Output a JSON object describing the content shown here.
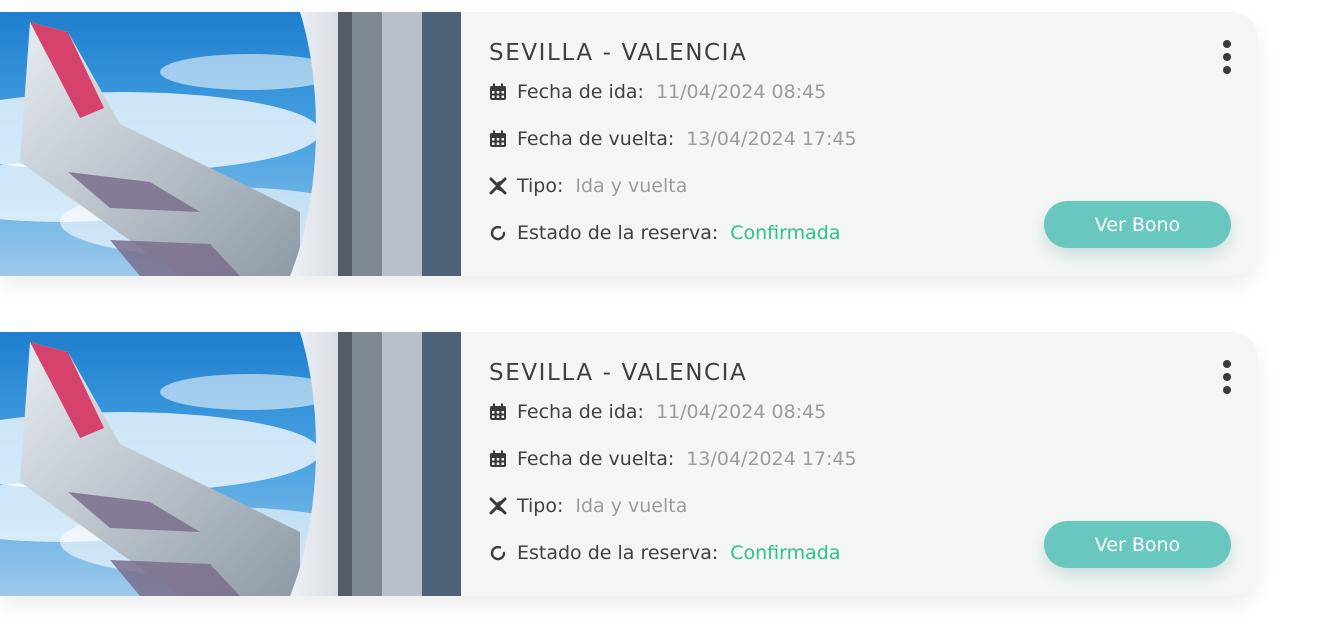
{
  "bookings": [
    {
      "route": "SEVILLA - VALENCIA",
      "departure_label": "Fecha de ida:",
      "departure_value": "11/04/2024 08:45",
      "return_label": "Fecha de vuelta:",
      "return_value": "13/04/2024 17:45",
      "type_label": "Tipo:",
      "type_value": "Ida y vuelta",
      "status_label": "Estado de la reserva:",
      "status_value": "Confirmada",
      "action_label": "Ver Bono"
    },
    {
      "route": "SEVILLA - VALENCIA",
      "departure_label": "Fecha de ida:",
      "departure_value": "11/04/2024 08:45",
      "return_label": "Fecha de vuelta:",
      "return_value": "13/04/2024 17:45",
      "type_label": "Tipo:",
      "type_value": "Ida y vuelta",
      "status_label": "Estado de la reserva:",
      "status_value": "Confirmada",
      "action_label": "Ver Bono"
    }
  ],
  "icons": {
    "date": "calendar-icon",
    "type": "airplane-icon",
    "status": "refresh-icon",
    "menu": "more-vertical-icon"
  },
  "colors": {
    "accent": "#68c7be",
    "status_ok": "#2ec08a",
    "card_bg": "#f4f6f5"
  }
}
